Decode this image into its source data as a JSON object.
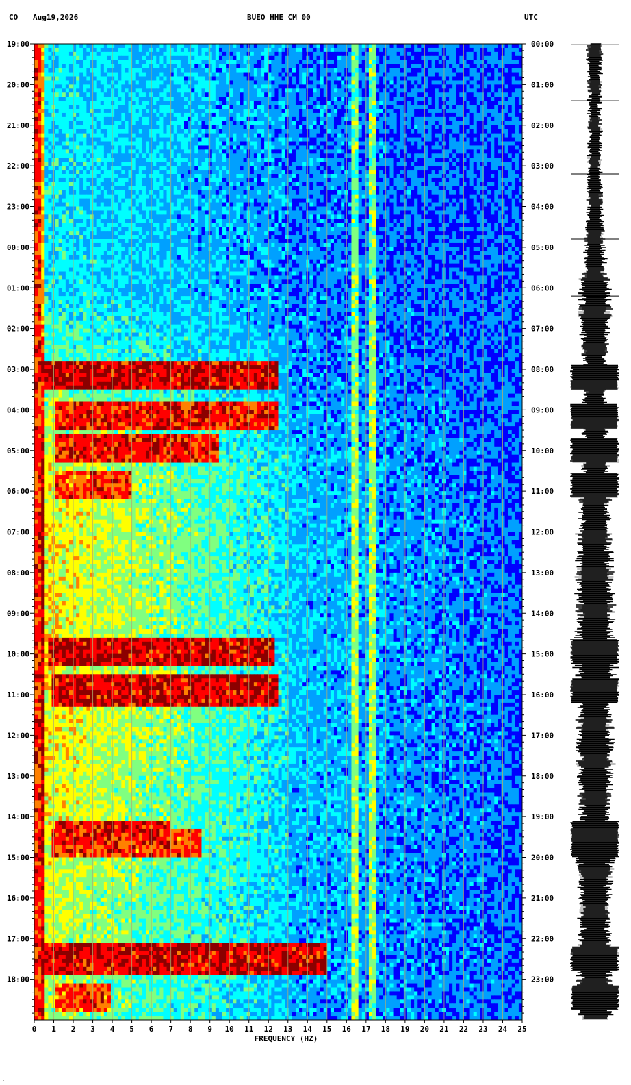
{
  "header": {
    "network": "CO",
    "date": "Aug19,2026",
    "channel_title": "BUEO HHE CM 00",
    "timezone": "UTC"
  },
  "footer_mark": "·",
  "chart_data": {
    "type": "heatmap",
    "title": "BUEO HHE CM 00",
    "xlabel": "FREQUENCY (HZ)",
    "ylabel": "",
    "xlim": [
      0,
      25
    ],
    "x_ticks": [
      "0",
      "1",
      "2",
      "3",
      "4",
      "5",
      "6",
      "7",
      "8",
      "9",
      "10",
      "11",
      "12",
      "13",
      "14",
      "15",
      "16",
      "17",
      "18",
      "19",
      "20",
      "21",
      "22",
      "23",
      "24",
      "25"
    ],
    "y_left_ticks": [
      "19:00",
      "20:00",
      "21:00",
      "22:00",
      "23:00",
      "00:00",
      "01:00",
      "02:00",
      "03:00",
      "04:00",
      "05:00",
      "06:00",
      "07:00",
      "08:00",
      "09:00",
      "10:00",
      "11:00",
      "12:00",
      "13:00",
      "14:00",
      "15:00",
      "16:00",
      "17:00",
      "18:00"
    ],
    "y_right_ticks": [
      "00:00",
      "01:00",
      "02:00",
      "03:00",
      "04:00",
      "05:00",
      "06:00",
      "07:00",
      "08:00",
      "09:00",
      "10:00",
      "11:00",
      "12:00",
      "13:00",
      "14:00",
      "15:00",
      "16:00",
      "17:00",
      "18:00",
      "19:00",
      "20:00",
      "21:00",
      "22:00",
      "23:00"
    ],
    "grid": true,
    "colormap": [
      "#00008b",
      "#0000ff",
      "#00a0ff",
      "#00ffff",
      "#80ff80",
      "#ffff00",
      "#ff8000",
      "#ff0000",
      "#8b0000"
    ],
    "persistent_lines_hz": [
      16.4,
      17.3
    ],
    "hot_events": [
      {
        "time_hr": 8.2,
        "freq": [
          0.4,
          12.5
        ],
        "level": 1.0
      },
      {
        "time_hr": 9.15,
        "freq": [
          1.0,
          12.5
        ],
        "level": 0.95
      },
      {
        "time_hr": 10.0,
        "freq": [
          1.0,
          9.5
        ],
        "level": 0.95
      },
      {
        "time_hr": 10.85,
        "freq": [
          1.0,
          5.0
        ],
        "level": 0.9
      },
      {
        "time_hr": 14.95,
        "freq": [
          0.8,
          12.3
        ],
        "level": 1.0
      },
      {
        "time_hr": 15.9,
        "freq": [
          0.9,
          12.5
        ],
        "level": 1.0
      },
      {
        "time_hr": 19.4,
        "freq": [
          1.0,
          7.0
        ],
        "level": 0.95
      },
      {
        "time_hr": 19.7,
        "freq": [
          0.9,
          8.5
        ],
        "level": 0.9
      },
      {
        "time_hr": 22.5,
        "freq": [
          0.4,
          15.0
        ],
        "level": 1.0
      },
      {
        "time_hr": 23.45,
        "freq": [
          1.0,
          4.0
        ],
        "level": 0.9
      }
    ],
    "seismogram_amplitude": [
      0.35,
      0.3,
      0.3,
      0.28,
      0.3,
      0.32,
      0.3,
      0.32,
      0.35,
      0.4,
      0.45,
      0.55,
      0.7,
      0.75,
      0.65,
      0.6,
      0.55,
      0.5,
      0.55,
      0.6,
      0.62,
      0.65,
      0.7,
      0.72,
      0.75,
      0.8,
      0.85,
      0.9,
      0.88,
      0.85,
      0.9,
      1.0,
      0.9,
      0.85,
      0.8,
      0.85,
      0.85,
      0.8,
      0.75,
      0.7,
      0.8,
      0.85,
      0.8,
      0.75,
      0.7,
      0.7,
      0.75,
      0.8,
      0.85,
      0.8
    ]
  }
}
